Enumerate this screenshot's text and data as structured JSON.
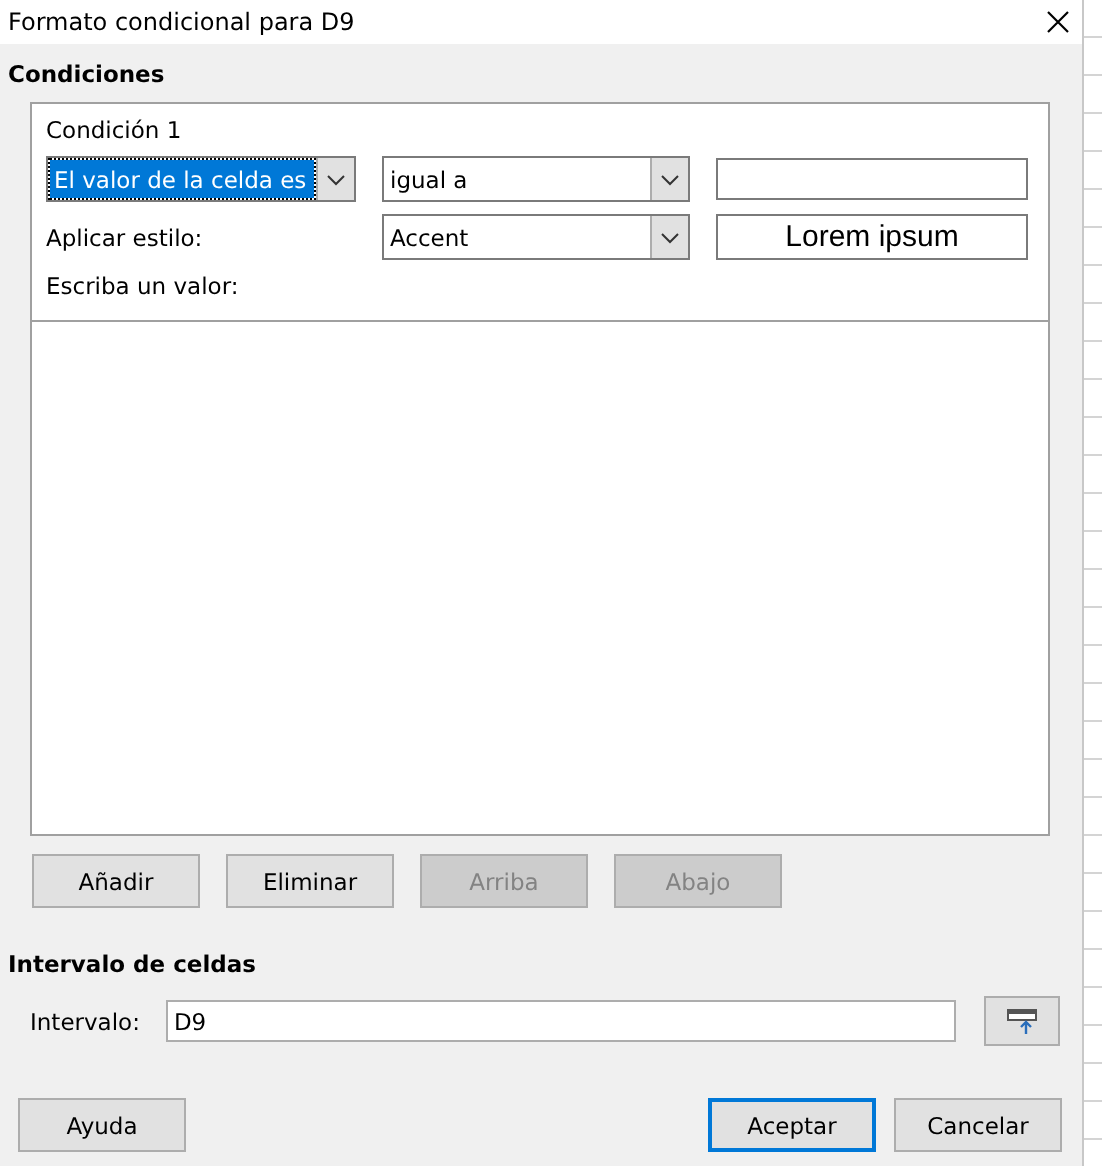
{
  "window": {
    "title": "Formato condicional para D9"
  },
  "conditions": {
    "heading": "Condiciones",
    "items": [
      {
        "title": "Condición 1",
        "type_dropdown": {
          "value": "El valor de la celda es",
          "selected": true
        },
        "operator_dropdown": {
          "value": "igual a",
          "selected": false
        },
        "style_label": "Aplicar estilo:",
        "style_dropdown": {
          "value": "Accent",
          "selected": false
        },
        "preview": "Lorem ipsum",
        "hint": "Escriba un valor:"
      }
    ]
  },
  "list_buttons": [
    {
      "label": "Añadir",
      "disabled": false
    },
    {
      "label": "Eliminar",
      "disabled": false
    },
    {
      "label": "Arriba",
      "disabled": true
    },
    {
      "label": "Abajo",
      "disabled": true
    }
  ],
  "range": {
    "heading": "Intervalo de celdas",
    "label": "Intervalo:",
    "value": "D9"
  },
  "footer": {
    "help": "Ayuda",
    "buttons": [
      {
        "label": "Aceptar",
        "default": true
      },
      {
        "label": "Cancelar",
        "default": false
      }
    ]
  }
}
